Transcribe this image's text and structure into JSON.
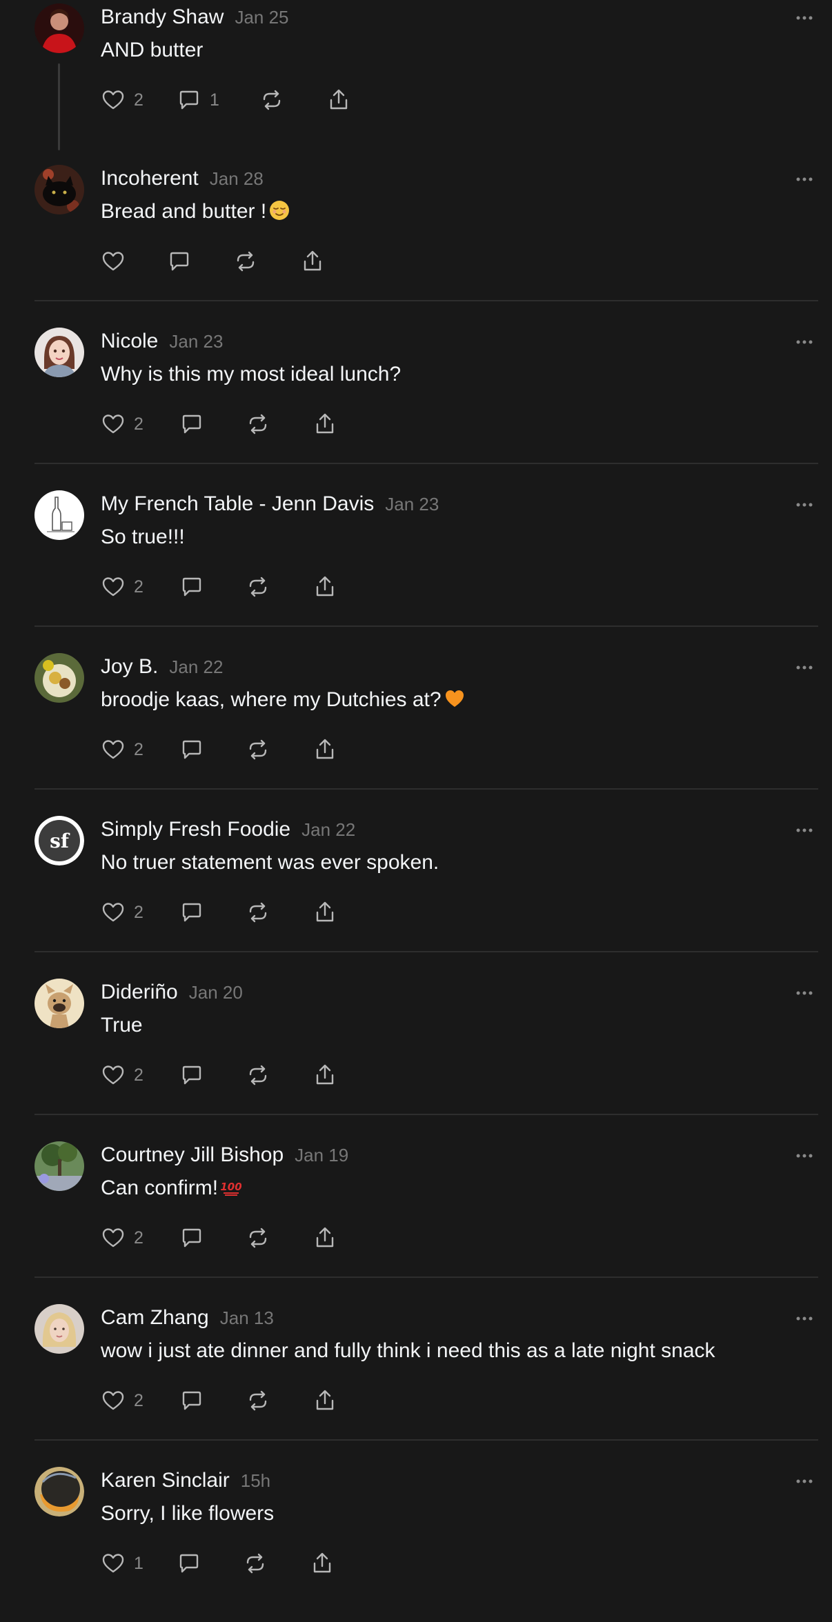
{
  "posts": [
    {
      "name": "Brandy Shaw",
      "date": "Jan 25",
      "text": "AND butter",
      "likes": "2",
      "replies": "1",
      "emoji": "",
      "avatar": "red-person",
      "threaded": true
    },
    {
      "name": "Incoherent",
      "date": "Jan 28",
      "text": "Bread and butter !",
      "likes": "",
      "replies": "",
      "emoji": "relieved-face",
      "avatar": "black-cat"
    },
    {
      "name": "Nicole",
      "date": "Jan 23",
      "text": "Why is this my most ideal lunch?",
      "likes": "2",
      "replies": "",
      "emoji": "",
      "avatar": "cartoon-girl"
    },
    {
      "name": "My French Table - Jenn Davis",
      "date": "Jan 23",
      "text": "So true!!!",
      "likes": "2",
      "replies": "",
      "emoji": "",
      "avatar": "sketch-bottle"
    },
    {
      "name": "Joy B.",
      "date": "Jan 22",
      "text": "broodje kaas, where my Dutchies at?",
      "likes": "2",
      "replies": "",
      "emoji": "orange-heart",
      "avatar": "food-plate"
    },
    {
      "name": "Simply Fresh Foodie",
      "date": "Jan 22",
      "text": "No truer statement was ever spoken.",
      "likes": "2",
      "replies": "",
      "emoji": "",
      "avatar": "sf-logo",
      "logo_text": "sf"
    },
    {
      "name": "Dideriño",
      "date": "Jan 20",
      "text": "True",
      "likes": "2",
      "replies": "",
      "emoji": "",
      "avatar": "french-bulldog"
    },
    {
      "name": "Courtney Jill Bishop",
      "date": "Jan 19",
      "text": "Can confirm!",
      "likes": "2",
      "replies": "",
      "emoji": "hundred-points",
      "avatar": "tree-photo"
    },
    {
      "name": "Cam Zhang",
      "date": "Jan 13",
      "text": "wow i just ate dinner and fully think i need this as a late night snack",
      "likes": "2",
      "replies": "",
      "emoji": "",
      "avatar": "blonde-person"
    },
    {
      "name": "Karen Sinclair",
      "date": "15h",
      "text": "Sorry, I like flowers",
      "likes": "1",
      "replies": "",
      "emoji": "",
      "avatar": "dark-orb"
    }
  ],
  "icons": {
    "like": "heart-icon",
    "reply": "comment-icon",
    "repost": "repost-icon",
    "share": "share-icon",
    "more": "more-options-icon"
  },
  "colors": {
    "background": "#181818",
    "text": "#f3f5f7",
    "muted": "#777777",
    "divider": "#2e2e2e",
    "icon": "#b8b8b8"
  }
}
